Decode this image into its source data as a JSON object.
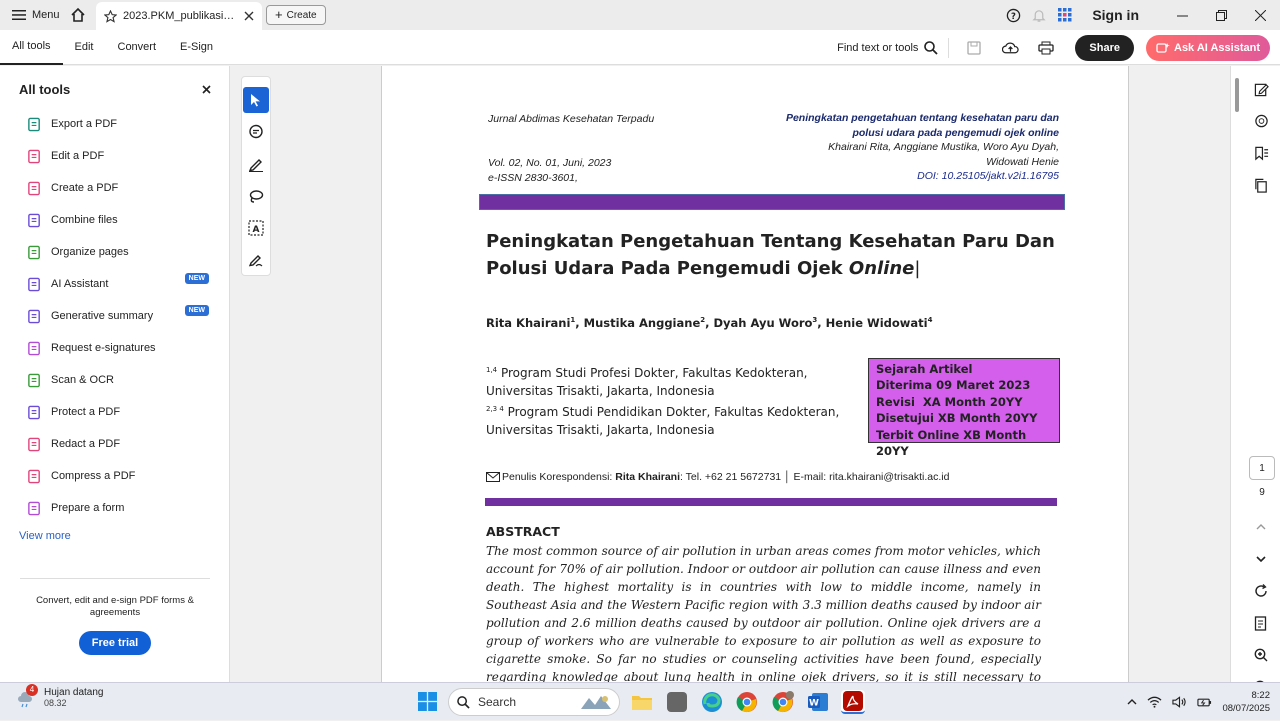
{
  "titlebar": {
    "menu_label": "Menu",
    "tab_title": "2023.PKM_publikasi_oj...",
    "create_label": "Create",
    "sign_in": "Sign in"
  },
  "toolbar": {
    "tabs": [
      "All tools",
      "Edit",
      "Convert",
      "E-Sign"
    ],
    "find_label": "Find text or tools",
    "share_label": "Share",
    "ai_label": "Ask AI Assistant"
  },
  "left_panel": {
    "title": "All tools",
    "items": [
      {
        "label": "Export a PDF",
        "icon": "export-pdf-icon",
        "color": "#1a8a7a"
      },
      {
        "label": "Edit a PDF",
        "icon": "edit-pdf-icon",
        "color": "#e0457b"
      },
      {
        "label": "Create a PDF",
        "icon": "create-pdf-icon",
        "color": "#e0457b"
      },
      {
        "label": "Combine files",
        "icon": "combine-files-icon",
        "color": "#6a4cd6"
      },
      {
        "label": "Organize pages",
        "icon": "organize-pages-icon",
        "color": "#3a9a3a"
      },
      {
        "label": "AI Assistant",
        "icon": "ai-assistant-icon",
        "color": "#6a4cd6",
        "badge": "NEW"
      },
      {
        "label": "Generative summary",
        "icon": "generative-summary-icon",
        "color": "#6a4cd6",
        "badge": "NEW"
      },
      {
        "label": "Request e-signatures",
        "icon": "request-esign-icon",
        "color": "#b04cd6"
      },
      {
        "label": "Scan & OCR",
        "icon": "scan-ocr-icon",
        "color": "#3a9a3a"
      },
      {
        "label": "Protect a PDF",
        "icon": "protect-pdf-icon",
        "color": "#6a4cd6"
      },
      {
        "label": "Redact a PDF",
        "icon": "redact-pdf-icon",
        "color": "#e0457b"
      },
      {
        "label": "Compress a PDF",
        "icon": "compress-pdf-icon",
        "color": "#e0457b"
      },
      {
        "label": "Prepare a form",
        "icon": "prepare-form-icon",
        "color": "#b04cd6"
      }
    ],
    "view_more": "View more",
    "footer_text": "Convert, edit and e-sign PDF forms & agreements",
    "free_trial": "Free trial"
  },
  "document": {
    "header_left": [
      "Jurnal Abdimas Kesehatan Terpadu",
      "",
      "",
      "Vol. 02, No. 01, Juni, 2023",
      "e-ISSN 2830-3601,"
    ],
    "header_right_title1": "Peningkatan pengetahuan tentang kesehatan paru dan",
    "header_right_title2": "polusi udara pada pengemudi ojek online",
    "header_right_authors1": "Khairani Rita, Anggiane Mustika, Woro Ayu Dyah,",
    "header_right_authors2": "Widowati Henie",
    "header_right_doi": "DOI: 10.25105/jakt.v2i1.16795",
    "title_main": "Peningkatan Pengetahuan Tentang Kesehatan Paru Dan Polusi Udara Pada Pengemudi Ojek ",
    "title_italic": "Online",
    "authors": [
      {
        "name": "Rita Khairani",
        "sup": "1"
      },
      {
        "name": "Mustika Anggiane",
        "sup": "2"
      },
      {
        "name": "Dyah Ayu Woro",
        "sup": "3"
      },
      {
        "name": "Henie Widowati",
        "sup": "4"
      }
    ],
    "affil1_sup": "1,4",
    "affil1": "Program Studi Profesi Dokter, Fakultas Kedokteran, Universitas Trisakti, Jakarta, Indonesia",
    "affil2_sup": "2,3 4",
    "affil2": "Program Studi Pendidikan Dokter, Fakultas Kedokteran, Universitas Trisakti, Jakarta, Indonesia",
    "history": [
      "Sejarah Artikel",
      "Diterima 09 Maret 2023",
      "Revisi  XA Month 20YY",
      "Disetujui XB Month 20YY",
      "Terbit Online XB Month 20YY"
    ],
    "corresp_label": "Penulis Korespondensi: ",
    "corresp_name": "Rita Khairani",
    "corresp_rest": ": Tel. +62 21 5672731 │ E-mail: rita.khairani@trisakti.ac.id",
    "abstract_title": "ABSTRACT",
    "abstract_body": "The most common source of air pollution in urban areas comes from motor vehicles, which account for 70% of air pollution. Indoor or outdoor air pollution can cause illness and even death. The highest mortality is in countries with low to middle income, namely in Southeast Asia and the Western Pacific region with 3.3 million deaths caused by indoor air pollution and 2.6 million deaths caused by outdoor air pollution.  Online ojek drivers are a group of workers who are vulnerable to exposure to air pollution as well as exposure to cigarette smoke. So far no studies or counseling activities have been found, especially regarding knowledge about lung health in online ojek drivers, so it is still necessary to hold health service activities in the form of education about the importance of lung"
  },
  "right_rail": {
    "current_page": "1",
    "total_pages": "9"
  },
  "taskbar": {
    "weather_badge": "4",
    "weather_title": "Hujan datang",
    "weather_time": "08.32",
    "search_placeholder": "Search",
    "time": "8:22",
    "date": "08/07/2025"
  }
}
